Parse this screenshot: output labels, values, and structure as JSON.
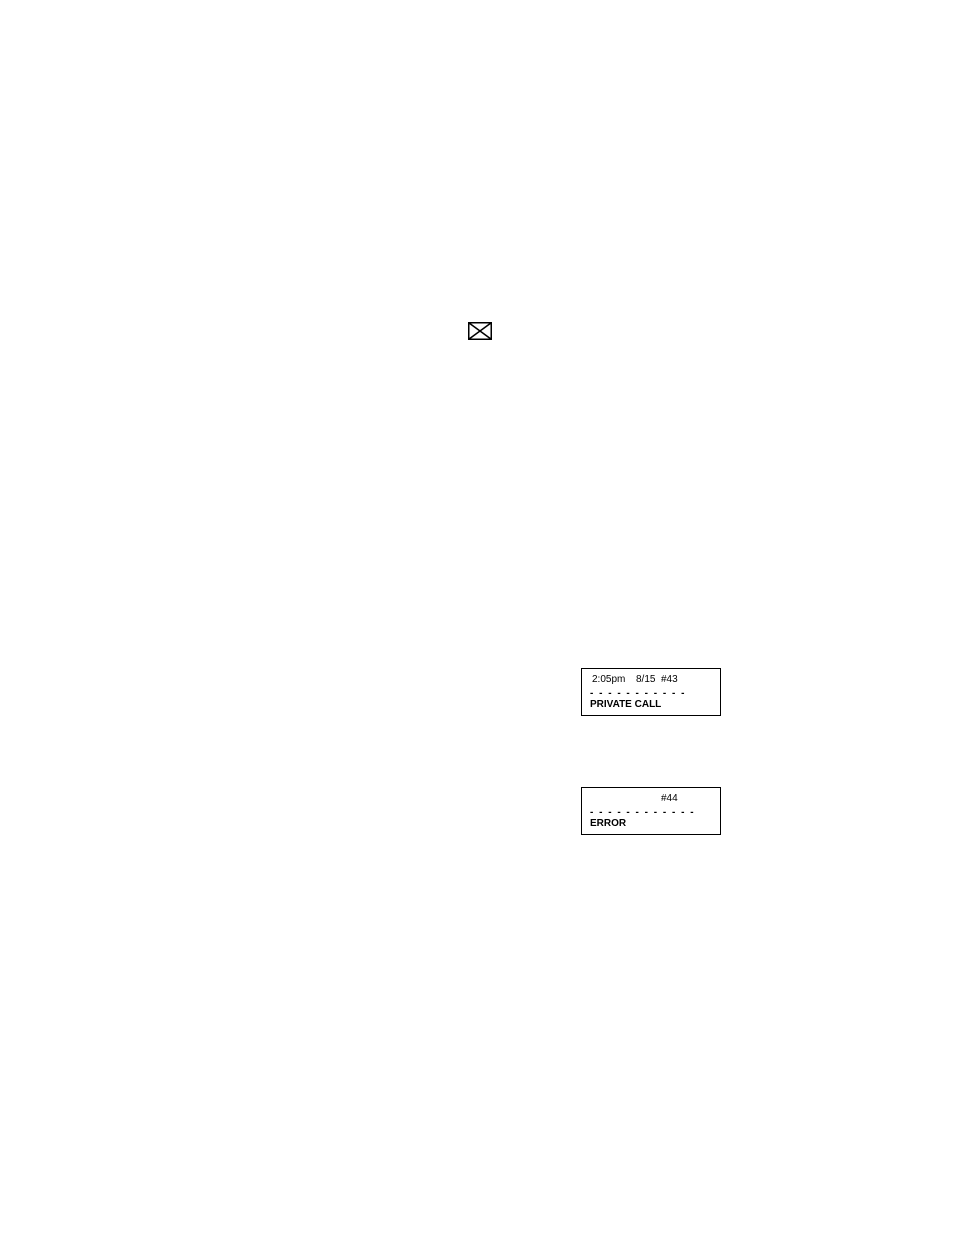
{
  "box1": {
    "time": "2:05pm",
    "date": "8/15",
    "num": "#43",
    "dashes": "- - - - - - - - - - -",
    "label": "PRIVATE CALL"
  },
  "box2": {
    "time": "",
    "date": "",
    "num": "#44",
    "dashes": "- - - - - - - - - - - -",
    "label": "ERROR"
  }
}
